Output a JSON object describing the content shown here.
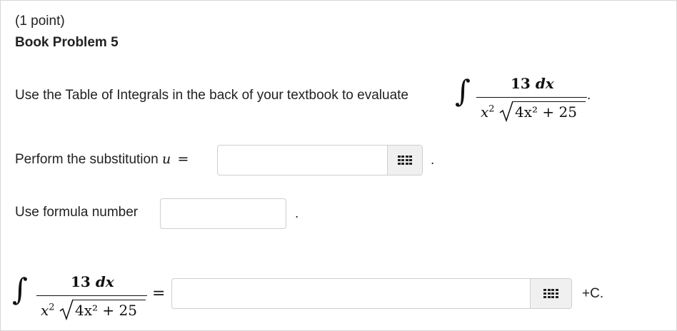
{
  "problem": {
    "points": "(1 point)",
    "title": "Book Problem 5",
    "instruction": "Use the Table of Integrals in the back of your textbook to evaluate",
    "integral": {
      "sign": "∫",
      "numerator_coef": "13",
      "numerator_dx": "dx",
      "denominator_x2": "x",
      "denominator_exp": "2",
      "radicand": "4x² + 25",
      "trailing": "."
    }
  },
  "substitution": {
    "label": "Perform the substitution ",
    "variable": "u",
    "equals": "=",
    "input_value": "",
    "trailing": "."
  },
  "formula": {
    "label": "Use formula number",
    "input_value": "",
    "trailing": "."
  },
  "result": {
    "equals": "=",
    "input_value": "",
    "suffix": "+C."
  },
  "icons": {
    "math_editor": "matrix-grid-icon"
  }
}
